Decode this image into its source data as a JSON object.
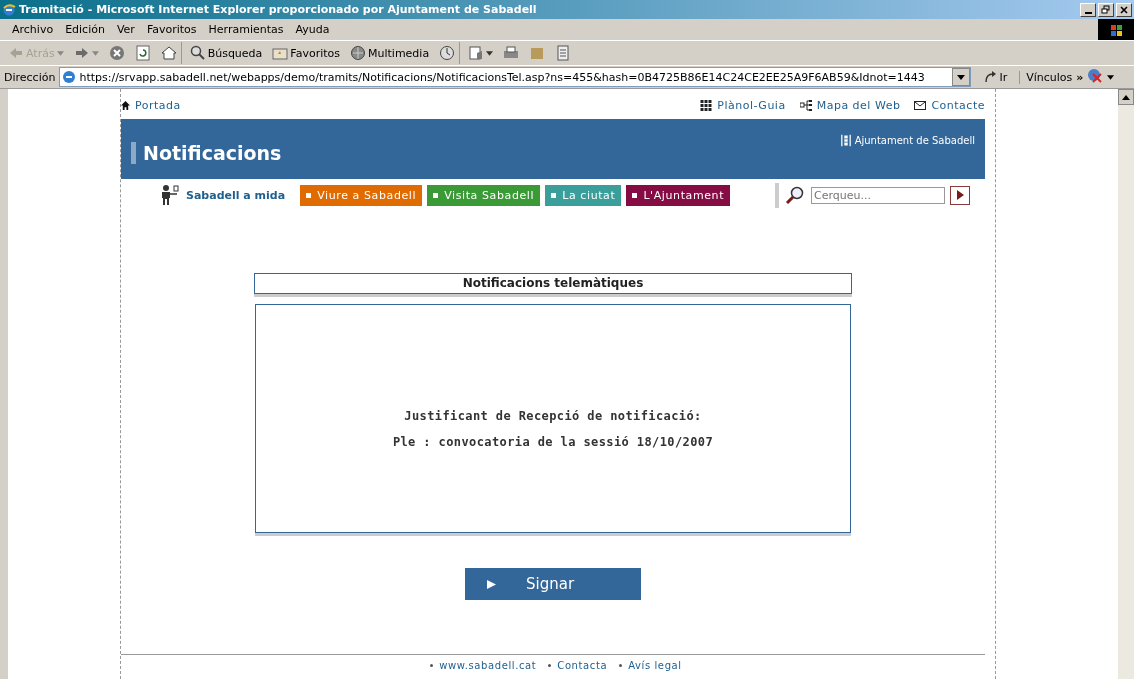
{
  "window": {
    "title": "Tramitació - Microsoft Internet Explorer proporcionado por Ajuntament de Sabadell"
  },
  "menu": [
    "Archivo",
    "Edición",
    "Ver",
    "Favoritos",
    "Herramientas",
    "Ayuda"
  ],
  "toolbar": [
    {
      "kind": "back",
      "label": "Atrás",
      "disabled": true
    },
    {
      "kind": "forward",
      "disabled": false
    },
    {
      "kind": "stop"
    },
    {
      "kind": "refresh"
    },
    {
      "kind": "home"
    },
    {
      "kind": "search",
      "label": "Búsqueda"
    },
    {
      "kind": "favorites",
      "label": "Favoritos"
    },
    {
      "kind": "media",
      "label": "Multimedia"
    },
    {
      "kind": "history"
    },
    {
      "kind": "mail"
    },
    {
      "kind": "print"
    },
    {
      "kind": "edit"
    },
    {
      "kind": "discuss"
    }
  ],
  "address": {
    "label": "Dirección",
    "value": "https://srvapp.sabadell.net/webapps/demo/tramits/Notificacions/NotificacionsTel.asp?ns=455&hash=0B4725B86E14C24CE2EE25A9F6AB59&Idnot=1443",
    "go": "Ir",
    "links": "Vínculos",
    "more": "»"
  },
  "page": {
    "home_link": "Portada",
    "top_links": [
      {
        "kind": "grid",
        "label": "Plànol-Guia"
      },
      {
        "kind": "sitemap",
        "label": "Mapa del Web"
      },
      {
        "kind": "mail",
        "label": "Contacte"
      }
    ],
    "header_title": "Notificacions",
    "brand": "Ajuntament de Sabadell",
    "profile_link": "Sabadell a mida",
    "sections": [
      {
        "label": "Viure a Sabadell",
        "color": "#e06b00"
      },
      {
        "label": "Visita Sabadell",
        "color": "#3a9a35"
      },
      {
        "label": "La ciutat",
        "color": "#3a9f9b"
      },
      {
        "label": "L'Ajuntament",
        "color": "#860c44"
      }
    ],
    "search": {
      "placeholder": "Cerqueu..."
    },
    "panel_title": "Notificacions telemàtiques",
    "lines": [
      "Justificant de Recepció de notificació:",
      "Ple : convocatoria de la sessió 18/10/2007"
    ],
    "sign_button": "Signar",
    "footer_links": [
      "www.sabadell.cat",
      "Contacta",
      "Avís legal"
    ]
  }
}
